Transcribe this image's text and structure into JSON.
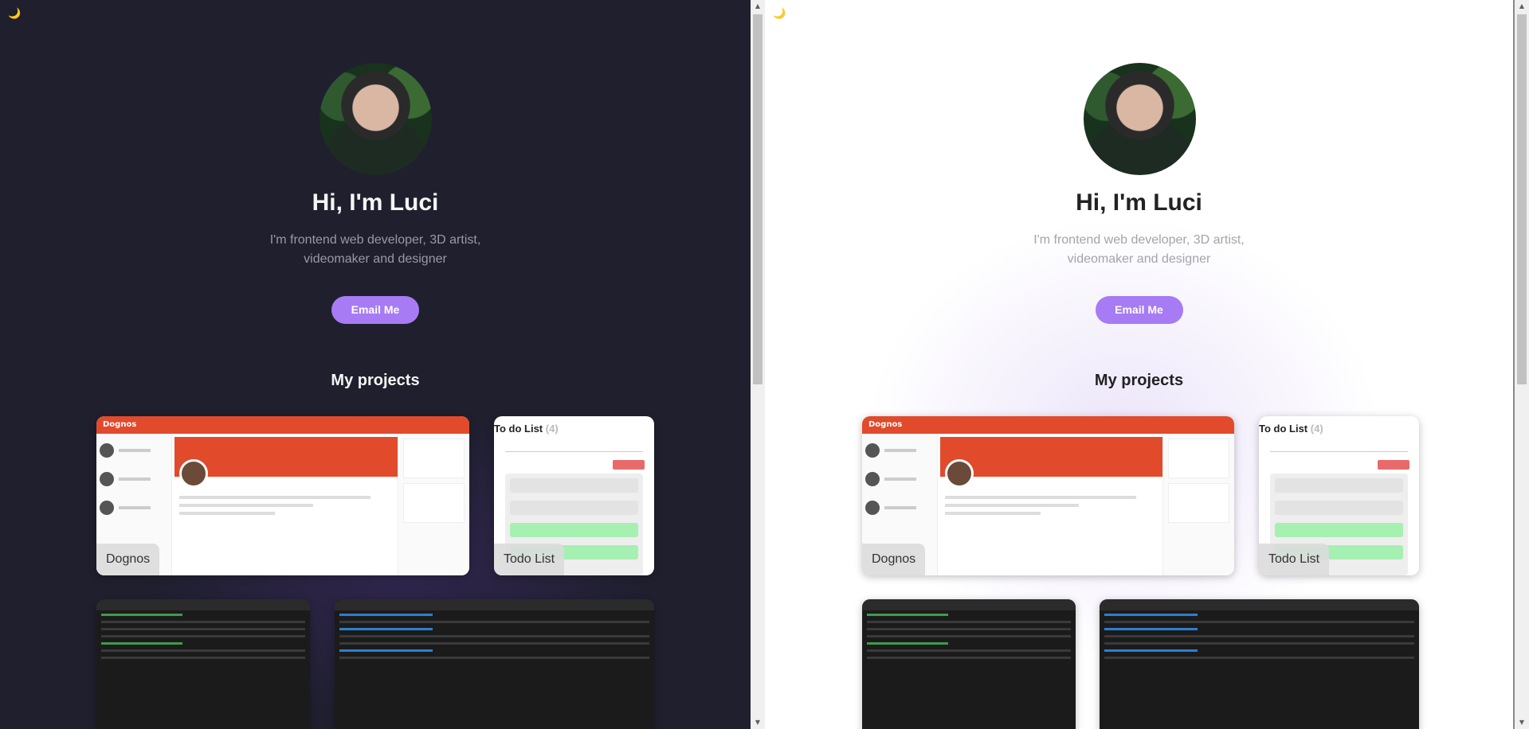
{
  "theme_toggle_icon": "moon-icon",
  "hero": {
    "greeting": "Hi, I'm Luci",
    "tagline": "I'm frontend web developer, 3D artist, videomaker and designer",
    "email_button": "Email Me"
  },
  "projects": {
    "heading": "My projects",
    "items": [
      {
        "label": "Dognos",
        "app_name": "Dognos"
      },
      {
        "label": "Todo List",
        "app_title": "To do List",
        "count": "(4)"
      }
    ]
  },
  "colors": {
    "dark_bg": "#1f1f2e",
    "light_bg": "#ffffff",
    "accent": "#a77bf3",
    "dognos_red": "#e24a2c"
  }
}
